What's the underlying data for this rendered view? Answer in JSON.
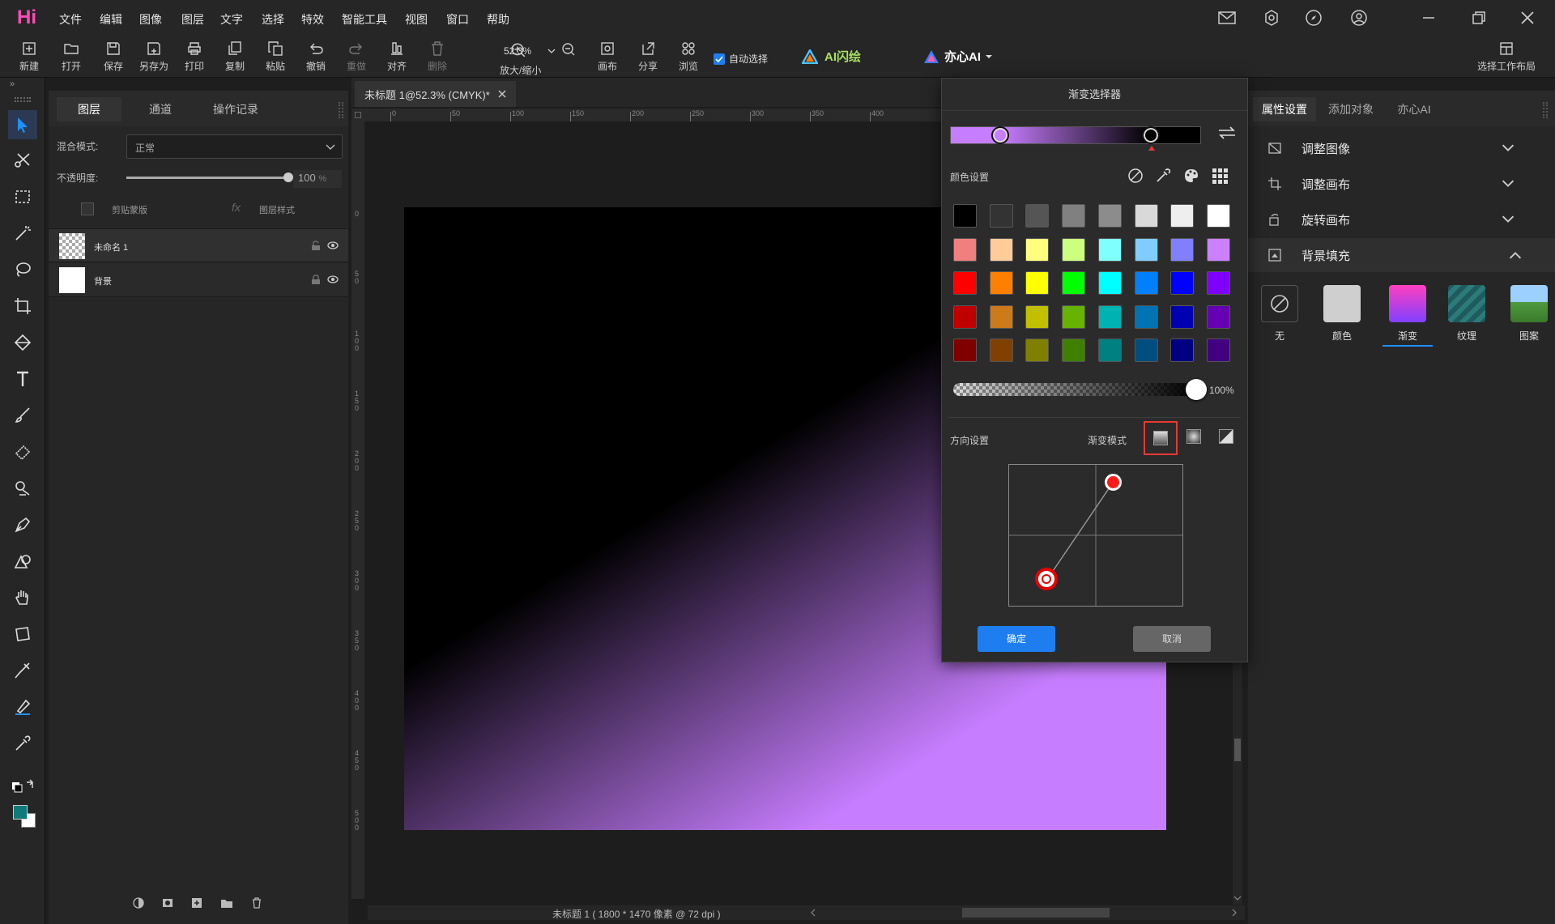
{
  "app": {
    "logo_text": "Hi"
  },
  "menu": [
    "文件",
    "编辑",
    "图像",
    "图层",
    "文字",
    "选择",
    "特效",
    "智能工具",
    "视图",
    "窗口",
    "帮助"
  ],
  "toolbar": {
    "buttons": [
      "新建",
      "打开",
      "保存",
      "另存为",
      "打印",
      "复制",
      "粘贴",
      "撤销",
      "重做",
      "对齐",
      "删除"
    ],
    "zoom_label": "放大/缩小",
    "zoom_value": "52.3%",
    "canvas": "画布",
    "share": "分享",
    "browse": "浏览",
    "auto_select": "自动选择",
    "ai_draw": "AI闪绘",
    "yixin_ai": "亦心AI",
    "workspace": "选择工作布局"
  },
  "layers_panel": {
    "tabs": [
      "图层",
      "通道",
      "操作记录"
    ],
    "blend_label": "混合模式:",
    "blend_value": "正常",
    "opacity_label": "不透明度:",
    "opacity_value": "100",
    "opacity_unit": "%",
    "opacity_fraction": 1.0,
    "clip_label": "剪贴蒙版",
    "fx_label": "fx",
    "style_label": "图层样式",
    "layers": [
      {
        "name": "未命名 1"
      },
      {
        "name": "背景"
      }
    ]
  },
  "document": {
    "tab_title": "未标题 1@52.3% (CMYK)*",
    "status": "未标题 1 ( 1800 * 1470 像素 @ 72 dpi )",
    "ruler_h": [
      "0",
      "50",
      "100",
      "150",
      "200",
      "250",
      "300",
      "350",
      "400"
    ],
    "ruler_v": [
      "0",
      "50",
      "100",
      "150",
      "200",
      "250",
      "300",
      "350",
      "400",
      "450",
      "500"
    ]
  },
  "gradient_dialog": {
    "title": "渐变选择器",
    "color_settings": "颜色设置",
    "opacity_value": "100%",
    "opacity_fraction": 1.0,
    "direction_label": "方向设置",
    "mode_label": "渐变模式",
    "ok": "确定",
    "cancel": "取消",
    "stops": [
      {
        "color": "#c77dff",
        "position": 0.2
      },
      {
        "color": "#000000",
        "position": 0.8
      }
    ],
    "palette": [
      [
        "#000000",
        "#333333",
        "#555555",
        "#808080",
        "#8c8c8c",
        "#d9d9d9",
        "#eeeeee",
        "#ffffff"
      ],
      [
        "#f08080",
        "#ffcc99",
        "#ffff80",
        "#ccff80",
        "#80ffff",
        "#80ccff",
        "#8080ff",
        "#cc80ff"
      ],
      [
        "#ff0000",
        "#ff8000",
        "#ffff00",
        "#00ff00",
        "#00ffff",
        "#0080ff",
        "#0000ff",
        "#8000ff"
      ],
      [
        "#c00000",
        "#cc7a1a",
        "#c0c000",
        "#66b300",
        "#00b3b3",
        "#0073b3",
        "#0000b3",
        "#6600b3"
      ],
      [
        "#800000",
        "#804000",
        "#808000",
        "#408000",
        "#008080",
        "#004d80",
        "#000080",
        "#400080"
      ]
    ]
  },
  "right_panel": {
    "tabs": [
      "属性设置",
      "添加对象",
      "亦心AI"
    ],
    "sections": [
      "调整图像",
      "调整画布",
      "旋转画布",
      "背景填充"
    ],
    "fill_options": [
      "无",
      "颜色",
      "渐变",
      "纹理",
      "图案"
    ]
  },
  "colors": {
    "accent": "#1e7ef0",
    "gradient_start": "#c77dff",
    "gradient_end": "#000000"
  }
}
